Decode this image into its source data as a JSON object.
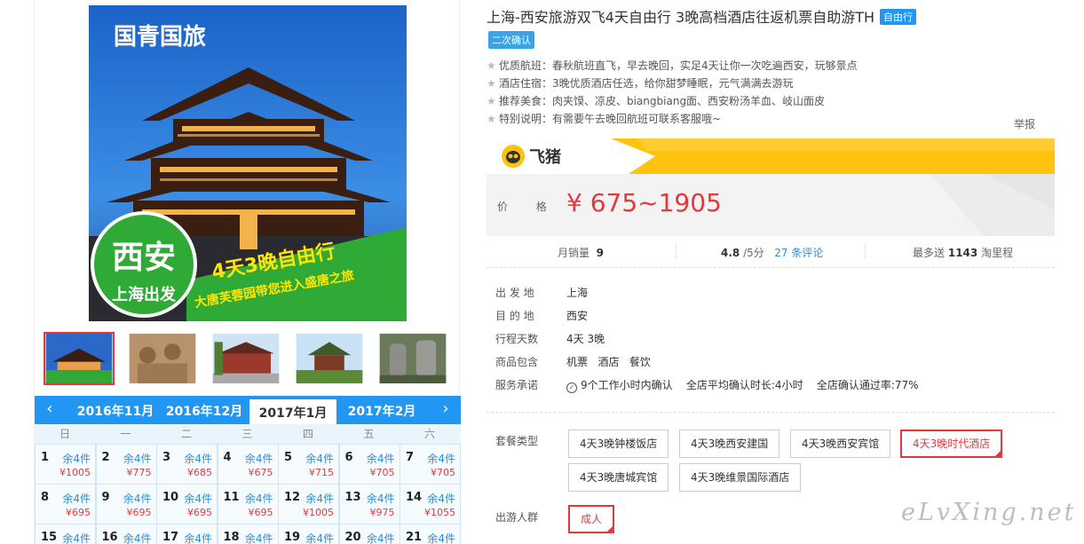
{
  "gallery": {
    "main_image": {
      "brand_text": "国青国旅",
      "city_text": "西安",
      "origin_text": "上海出发",
      "headline": "4天3晚自由行",
      "subline": "大唐芙蓉园带您进入盛唐之旅"
    },
    "thumbnails": [
      "thumb-main",
      "thumb-terracotta",
      "thumb-gate",
      "thumb-pavilion",
      "thumb-steles"
    ]
  },
  "calendar": {
    "months": [
      "2016年11月",
      "2016年12月",
      "2017年1月",
      "2017年2月"
    ],
    "active_month_index": 2,
    "weekdays": [
      "日",
      "一",
      "二",
      "三",
      "四",
      "五",
      "六"
    ],
    "days": [
      {
        "day": "1",
        "stock": "余4件",
        "price": "¥1005"
      },
      {
        "day": "2",
        "stock": "余4件",
        "price": "¥775"
      },
      {
        "day": "3",
        "stock": "余4件",
        "price": "¥685"
      },
      {
        "day": "4",
        "stock": "余4件",
        "price": "¥675"
      },
      {
        "day": "5",
        "stock": "余4件",
        "price": "¥715"
      },
      {
        "day": "6",
        "stock": "余4件",
        "price": "¥705"
      },
      {
        "day": "7",
        "stock": "余4件",
        "price": "¥705"
      },
      {
        "day": "8",
        "stock": "余4件",
        "price": "¥695"
      },
      {
        "day": "9",
        "stock": "余4件",
        "price": "¥695"
      },
      {
        "day": "10",
        "stock": "余4件",
        "price": "¥695"
      },
      {
        "day": "11",
        "stock": "余4件",
        "price": "¥695"
      },
      {
        "day": "12",
        "stock": "余4件",
        "price": "¥1005"
      },
      {
        "day": "13",
        "stock": "余4件",
        "price": "¥975"
      },
      {
        "day": "14",
        "stock": "余4件",
        "price": "¥1055"
      },
      {
        "day": "15",
        "stock": "余4件",
        "price": ""
      },
      {
        "day": "16",
        "stock": "余4件",
        "price": ""
      },
      {
        "day": "17",
        "stock": "余4件",
        "price": ""
      },
      {
        "day": "18",
        "stock": "余4件",
        "price": ""
      },
      {
        "day": "19",
        "stock": "余4件",
        "price": ""
      },
      {
        "day": "20",
        "stock": "余4件",
        "price": ""
      },
      {
        "day": "21",
        "stock": "余4件",
        "price": ""
      }
    ]
  },
  "product": {
    "title": "上海-西安旅游双飞4天自由行 3晚高档酒店往返机票自助游TH",
    "tag": "自由行",
    "tag2": "二次确认",
    "highlights": [
      "优质航班：春秋航班直飞，早去晚回，实足4天让你一次吃遍西安，玩够景点",
      "酒店住宿：3晚优质酒店任选，给你甜梦睡眠，元气满满去游玩",
      "推荐美食：肉夹馍、凉皮、biangbiang面、西安粉汤羊血、岐山面皮",
      "特别说明：有需要午去晚回航班可联系客服哦~"
    ],
    "report": "举报"
  },
  "price_box": {
    "brand": "飞猪",
    "label": "价 格",
    "price": "¥ 675~1905"
  },
  "stats": {
    "monthly_sales_label": "月销量",
    "monthly_sales": "9",
    "rating": "4.8",
    "rating_suffix": "/5分",
    "reviews": "27 条评论",
    "points_prefix": "最多送",
    "points": "1143",
    "points_suffix": "淘里程"
  },
  "info": [
    {
      "key": "出 发 地",
      "val": "上海"
    },
    {
      "key": "目 的 地",
      "val": "西安"
    },
    {
      "key": "行程天数",
      "val": "4天 3晚"
    },
    {
      "key": "商品包含",
      "val": "机票   酒店   餐饮"
    },
    {
      "key": "服务承诺",
      "val": "9个工作小时内确认    全店平均确认时长:4小时    全店确认通过率:77%"
    }
  ],
  "packages": {
    "label": "套餐类型",
    "options": [
      "4天3晚钟楼饭店",
      "4天3晚西安建国",
      "4天3晚西安宾馆",
      "4天3晚时代酒店",
      "4天3晚唐城宾馆",
      "4天3晚维景国际酒店"
    ],
    "selected_index": 3
  },
  "crowd": {
    "label": "出游人群",
    "option": "成人"
  },
  "watermark": "eLvXing.net",
  "colors": {
    "accent_blue": "#2196f3",
    "price_red": "#e4393c",
    "fliggy_yellow": "#ffc20e"
  }
}
